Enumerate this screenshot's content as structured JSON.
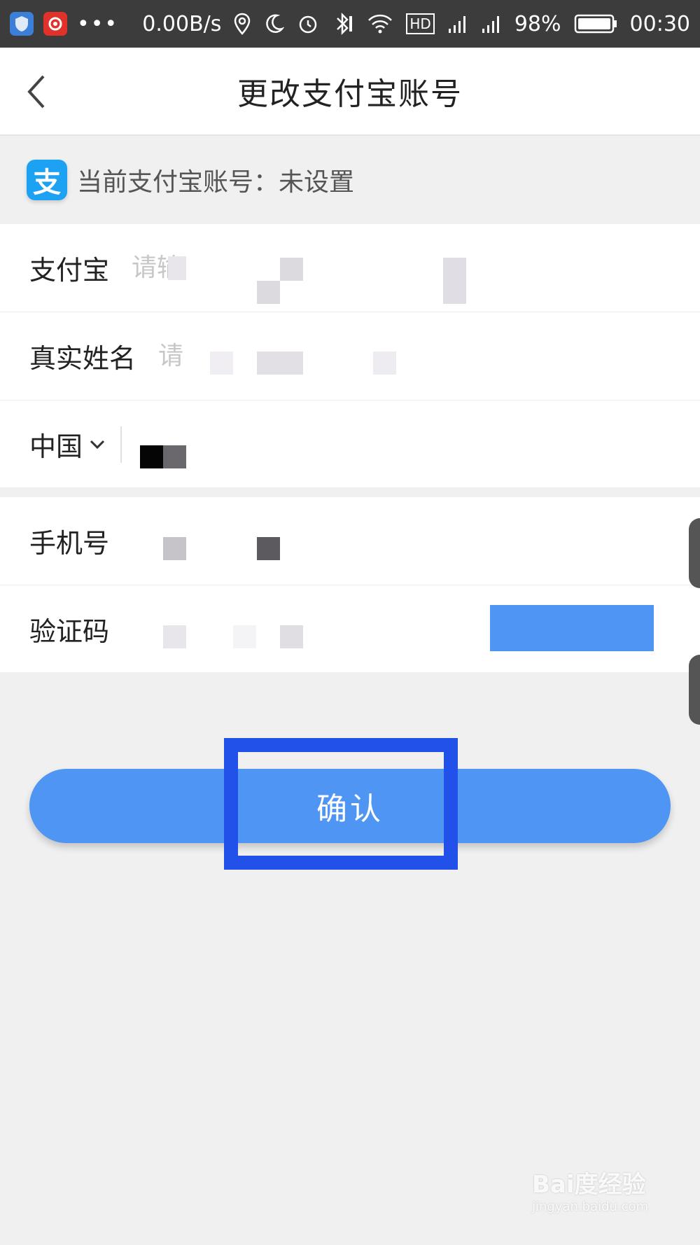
{
  "status_bar": {
    "speed": "0.00B/s",
    "network": "HD",
    "battery": "98%",
    "time": "00:30",
    "icons": [
      "shield-icon",
      "netease-music-icon",
      "more-dots-icon",
      "location-icon",
      "moon-icon",
      "alarm-icon",
      "bluetooth-icon",
      "wifi-icon",
      "hd-icon",
      "signal-icon",
      "signal-icon",
      "battery-icon"
    ]
  },
  "nav": {
    "title": "更改支付宝账号",
    "back_icon": "chevron-left-icon"
  },
  "current_account": {
    "text": "当前支付宝账号：未设置",
    "logo_char": "支",
    "logo_icon": "alipay-logo-icon"
  },
  "form": {
    "alipay": {
      "label": "支付宝",
      "placeholder": "请输"
    },
    "real_name": {
      "label": "真实姓名",
      "placeholder": "请"
    },
    "country": {
      "label": "中国",
      "icon": "chevron-down-icon"
    },
    "phone": {
      "label": "手机号"
    },
    "code": {
      "label": "验证码"
    }
  },
  "confirm": {
    "label": "确认"
  },
  "watermark": {
    "main": "Bai度经验",
    "sub": "jingyan.baidu.com"
  },
  "colors": {
    "primary": "#4f95f3",
    "highlight": "#2151e8",
    "status_bar": "#3c3c3c",
    "background": "#f0f0f0"
  }
}
